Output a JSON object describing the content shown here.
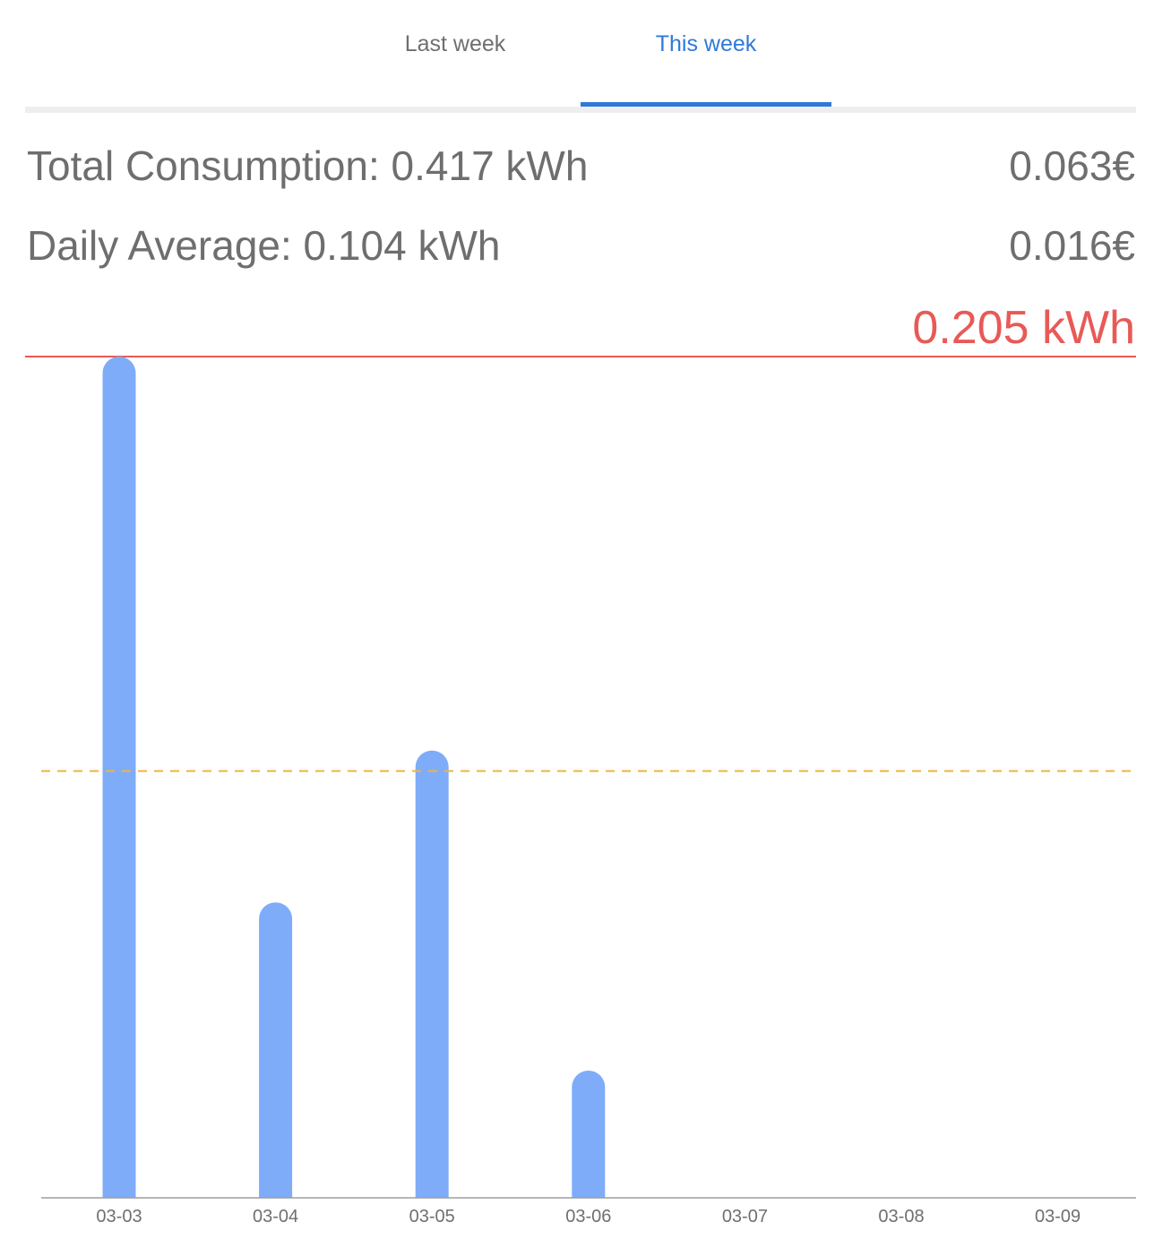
{
  "tabs": {
    "last_week": "Last week",
    "this_week": "This week",
    "active": "This week"
  },
  "stats": {
    "total_label": "Total Consumption: 0.417 kWh",
    "total_cost": "0.063€",
    "average_label": "Daily Average: 0.104 kWh",
    "average_cost": "0.016€"
  },
  "colors": {
    "accent": "#2f7ad8",
    "bar": "#7eacf9",
    "max_line": "#e85a57",
    "average_line": "#f0b43c",
    "text": "#6e6e6e"
  },
  "chart_data": {
    "type": "bar",
    "categories": [
      "03-03",
      "03-04",
      "03-05",
      "03-06",
      "03-07",
      "03-08",
      "03-09"
    ],
    "values": [
      0.205,
      0.072,
      0.109,
      0.031,
      0,
      0,
      0
    ],
    "unit": "kWh",
    "max_line": {
      "value": 0.205,
      "label": "0.205 kWh"
    },
    "average_line": {
      "value": 0.104,
      "style": "dashed"
    },
    "ylim": [
      0,
      0.205
    ],
    "grid": false,
    "legend": "none"
  }
}
